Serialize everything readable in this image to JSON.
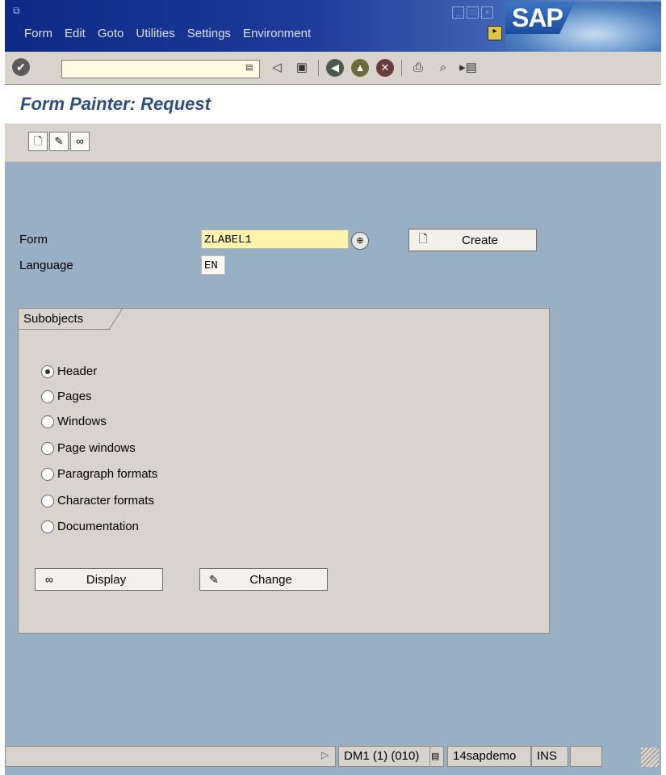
{
  "menubar": {
    "items": [
      "Form",
      "Edit",
      "Goto",
      "Utilities",
      "Settings",
      "Environment"
    ],
    "logo": "SAP"
  },
  "toolbar": {
    "icons": [
      "enter-icon",
      "save-icon",
      "back-icon",
      "exit-icon",
      "cancel-icon",
      "print-icon",
      "find-icon",
      "find-next-icon"
    ]
  },
  "title": "Form Painter: Request",
  "form": {
    "form_label": "Form",
    "form_value": "ZLABEL1",
    "language_label": "Language",
    "language_value": "EN",
    "create_label": "Create"
  },
  "subobjects": {
    "tab_label": "Subobjects",
    "options": [
      "Header",
      "Pages",
      "Windows",
      "Page windows",
      "Paragraph formats",
      "Character formats",
      "Documentation"
    ],
    "selected": "Header",
    "display_label": "Display",
    "change_label": "Change"
  },
  "status": {
    "system": "DM1 (1) (010)",
    "server": "14sapdemo",
    "mode": "INS"
  }
}
